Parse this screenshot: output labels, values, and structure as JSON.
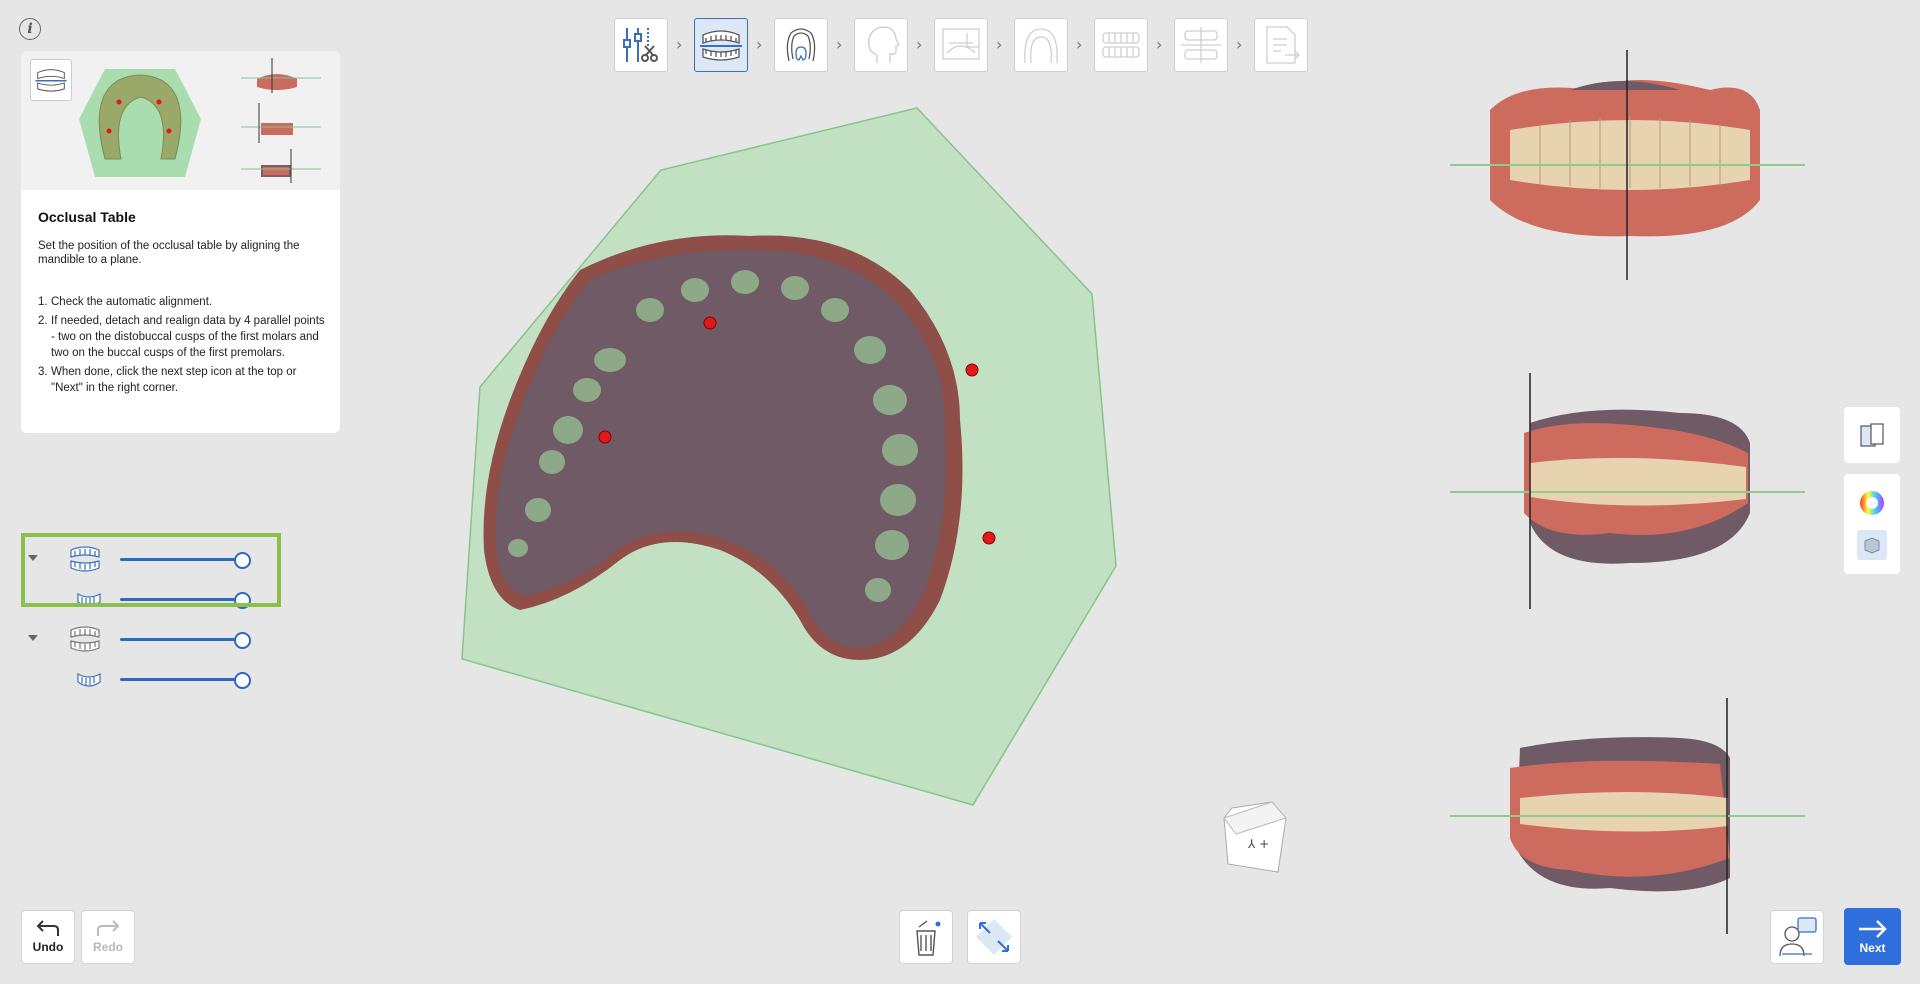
{
  "header": {
    "info_icon_label": "i",
    "steps": [
      {
        "name": "data-prep",
        "icon": "align-tools-icon",
        "state": "done"
      },
      {
        "name": "occlusal-table",
        "icon": "jaw-arch-icon",
        "state": "active"
      },
      {
        "name": "tooth-info",
        "icon": "tooth-chart-icon",
        "state": "enabled"
      },
      {
        "name": "face-scan",
        "icon": "face-profile-icon",
        "state": "disabled"
      },
      {
        "name": "xray-align",
        "icon": "xray-icon",
        "state": "disabled"
      },
      {
        "name": "arch-design",
        "icon": "arch-icon",
        "state": "disabled"
      },
      {
        "name": "smile-design",
        "icon": "teeth-icon",
        "state": "disabled"
      },
      {
        "name": "bite-design",
        "icon": "bite-icon",
        "state": "disabled"
      },
      {
        "name": "export",
        "icon": "export-doc-icon",
        "state": "disabled"
      }
    ]
  },
  "guide": {
    "title": "Occlusal Table",
    "description": "Set the position of the occlusal table by aligning the mandible to a plane.",
    "steps": [
      {
        "num": "1.",
        "text": "Check the automatic alignment."
      },
      {
        "num": "2.",
        "text": "If needed, detach and realign data by 4 parallel points - two on the distobuccal cusps of the first molars and two on the buccal cusps of the first premolars."
      },
      {
        "num": "3.",
        "text": "When done, click the next step icon at the top or \"Next\" in the right corner."
      }
    ]
  },
  "data_tree": {
    "rows": [
      {
        "name": "group-1",
        "icon": "jaw-group-icon",
        "expandable": true,
        "opacity": 1.0
      },
      {
        "name": "group-1-child",
        "icon": "mandible-icon",
        "expandable": false,
        "opacity": 1.0
      },
      {
        "name": "group-2",
        "icon": "jaw-group-icon",
        "expandable": true,
        "opacity": 1.0
      },
      {
        "name": "group-2-child",
        "icon": "mandible-icon",
        "expandable": false,
        "opacity": 1.0
      }
    ]
  },
  "bottom": {
    "undo_label": "Undo",
    "redo_label": "Redo",
    "next_label": "Next"
  },
  "colors": {
    "accent": "#2f6fdb",
    "selection": "#8cc04a",
    "plane": "#bfe1bf",
    "gum": "#cc6b5e",
    "tooth": "#e8d3b0",
    "mandible_model": "#6f5a66",
    "marker": "#e0191c"
  }
}
